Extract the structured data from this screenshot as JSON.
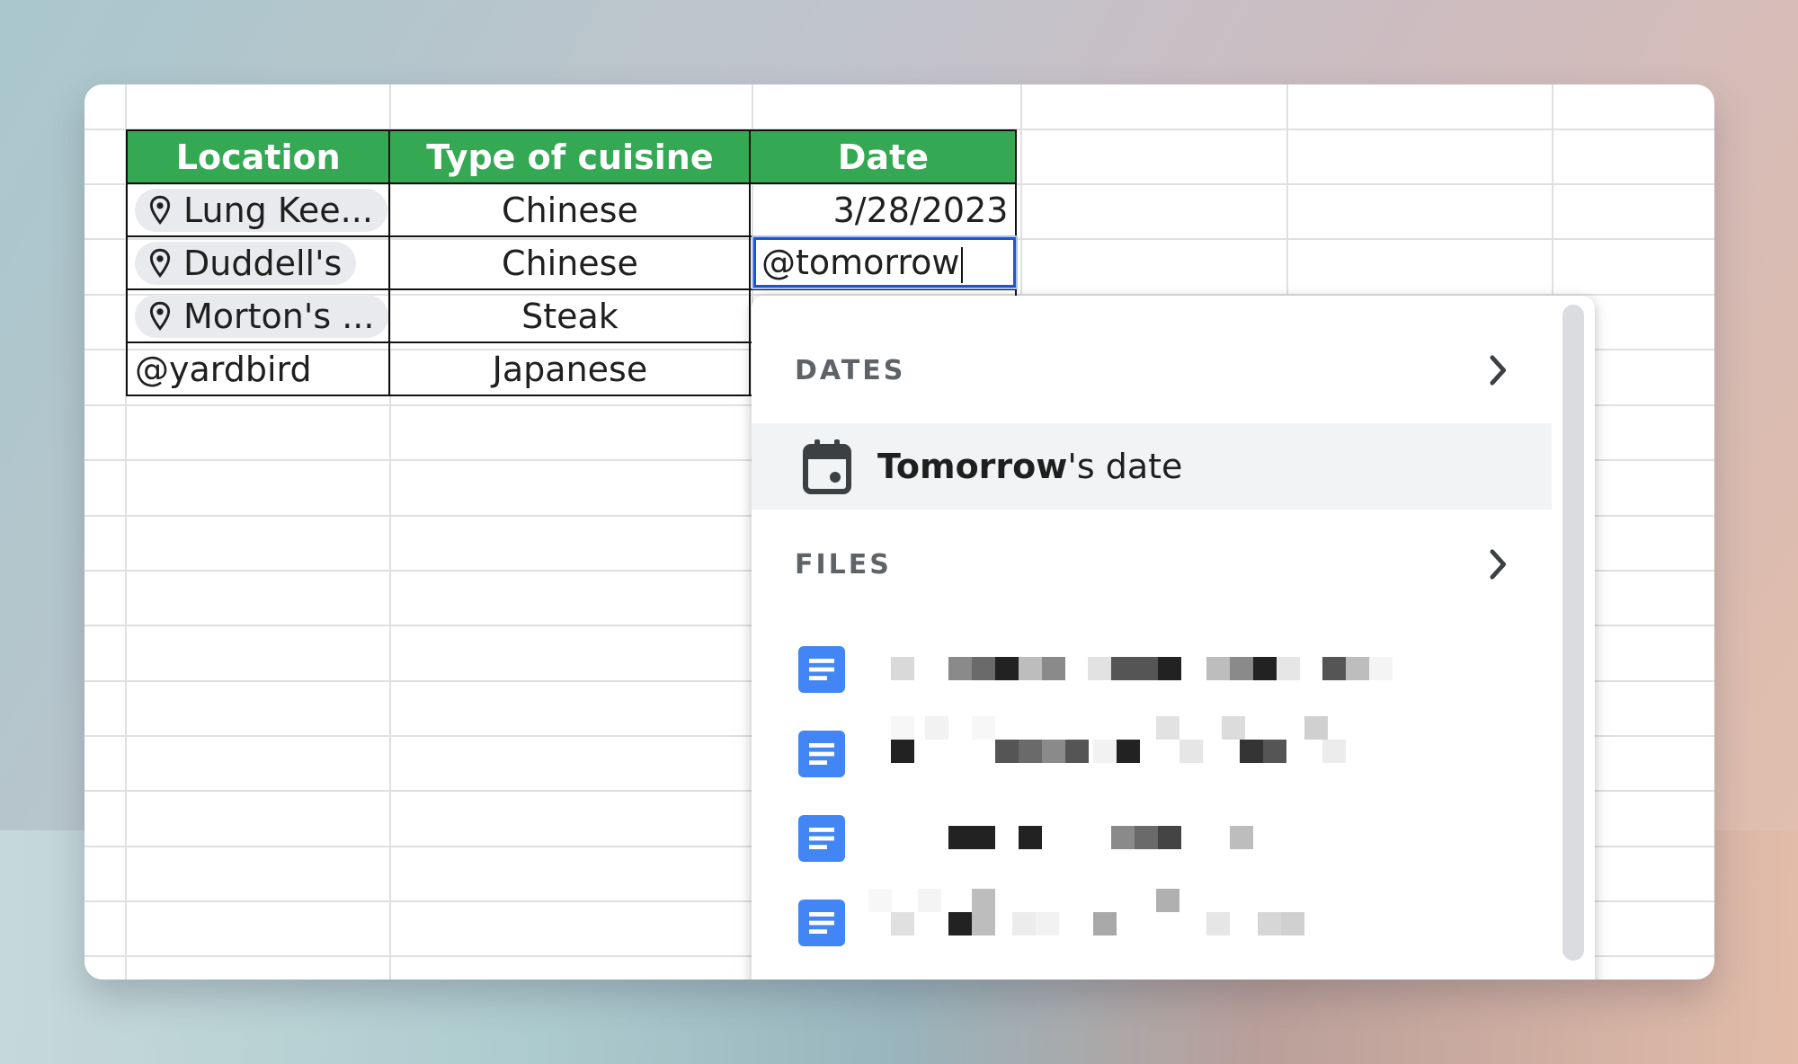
{
  "table": {
    "headers": [
      "Location",
      "Type of cuisine",
      "Date"
    ],
    "rows": [
      {
        "location": "Lung Kee...",
        "location_is_chip": true,
        "cuisine": "Chinese",
        "date": "3/28/2023"
      },
      {
        "location": "Duddell's",
        "location_is_chip": true,
        "cuisine": "Chinese",
        "date": ""
      },
      {
        "location": "Morton's ...",
        "location_is_chip": true,
        "cuisine": "Steak",
        "date": ""
      },
      {
        "location": "@yardbird",
        "location_is_chip": false,
        "cuisine": "Japanese",
        "date": ""
      }
    ]
  },
  "editor": {
    "value": "@tomorrow"
  },
  "popup": {
    "dates_title": "DATES",
    "suggestion_bold": "Tomorrow",
    "suggestion_rest": "'s date",
    "files_title": "FILES",
    "files_count": 4
  },
  "icons": {
    "location": "map-pin-icon",
    "calendar": "calendar-event-icon",
    "chevron": "chevron-right-icon",
    "doc": "google-docs-icon"
  },
  "colors": {
    "header_bg": "#34a853",
    "selection_border": "#1a56d6",
    "doc_icon": "#4285f4",
    "chip_bg": "#e8eaed"
  }
}
